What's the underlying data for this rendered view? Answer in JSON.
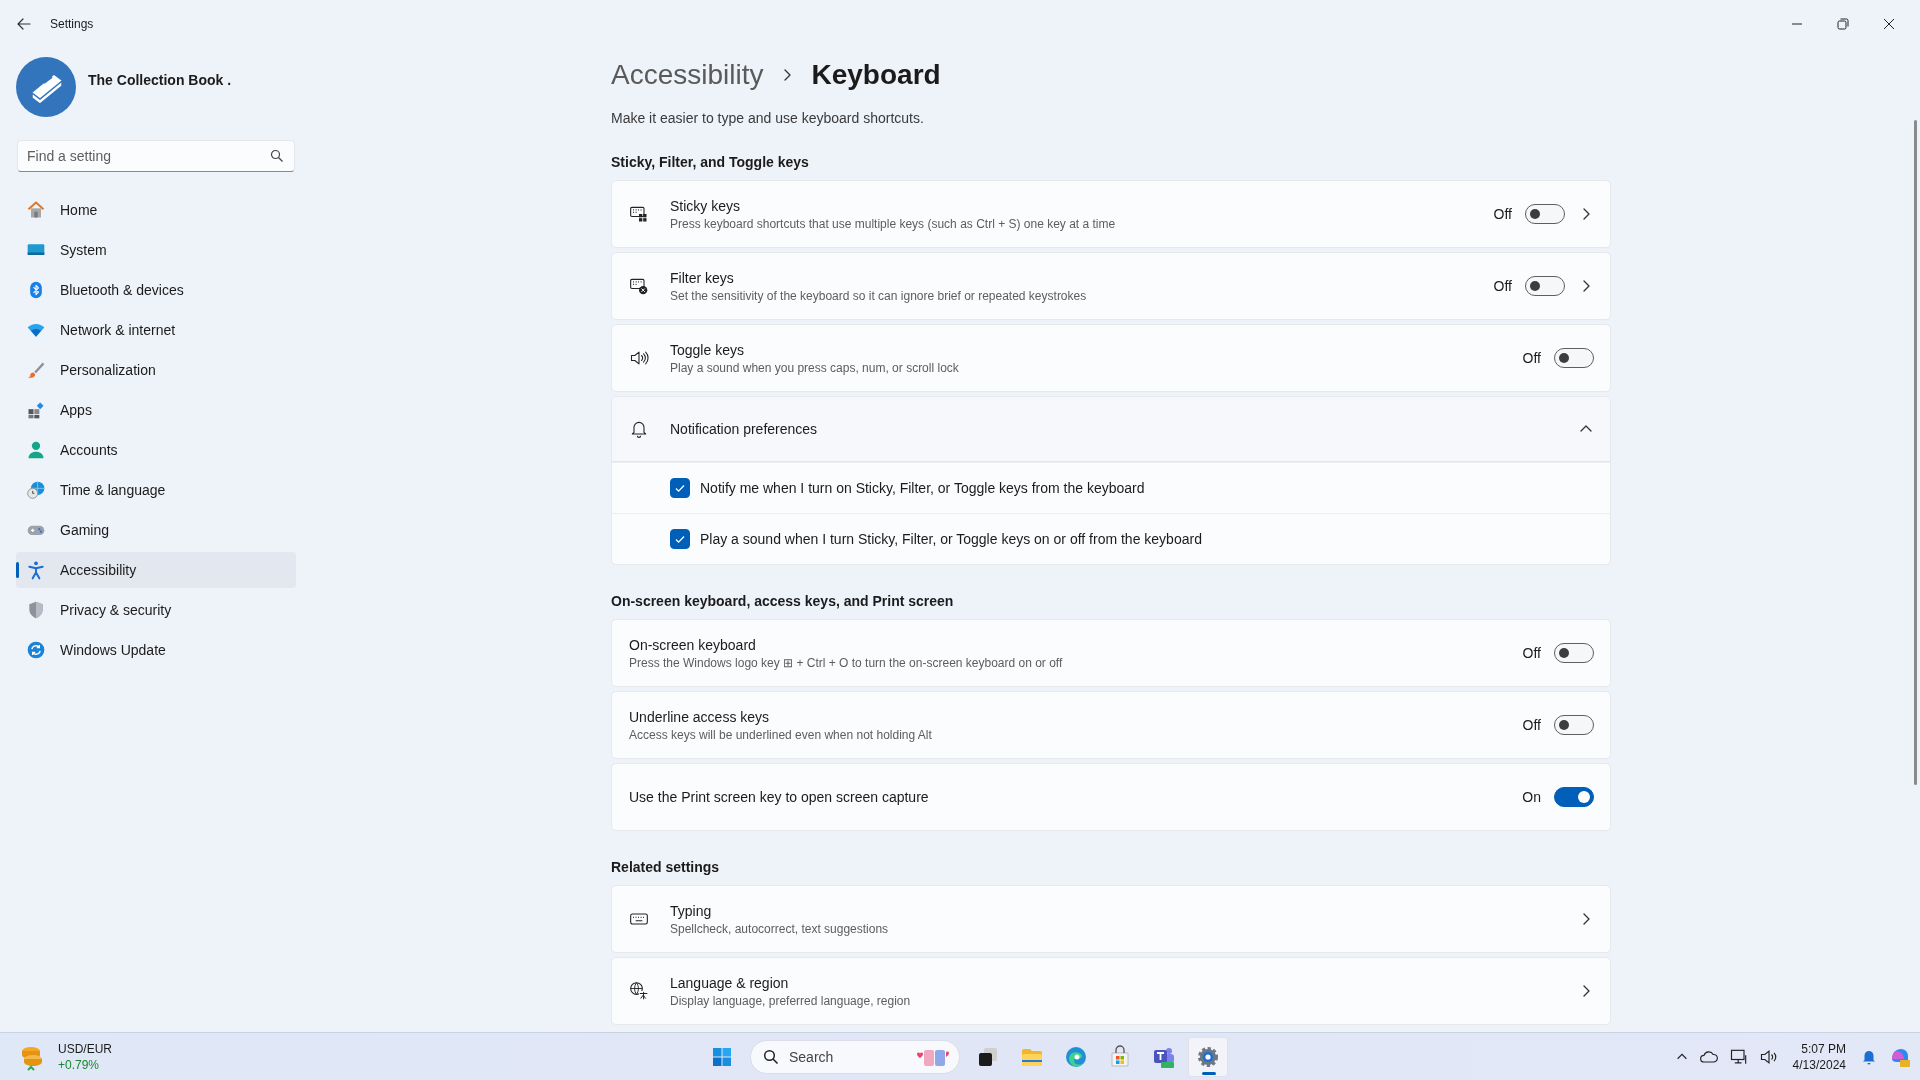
{
  "window": {
    "title": "Settings"
  },
  "profile": {
    "name": "The Collection Book ."
  },
  "search": {
    "placeholder": "Find a setting"
  },
  "nav": {
    "items": [
      {
        "label": "Home",
        "selected": false
      },
      {
        "label": "System",
        "selected": false
      },
      {
        "label": "Bluetooth & devices",
        "selected": false
      },
      {
        "label": "Network & internet",
        "selected": false
      },
      {
        "label": "Personalization",
        "selected": false
      },
      {
        "label": "Apps",
        "selected": false
      },
      {
        "label": "Accounts",
        "selected": false
      },
      {
        "label": "Time & language",
        "selected": false
      },
      {
        "label": "Gaming",
        "selected": false
      },
      {
        "label": "Accessibility",
        "selected": true
      },
      {
        "label": "Privacy & security",
        "selected": false
      },
      {
        "label": "Windows Update",
        "selected": false
      }
    ]
  },
  "breadcrumb": {
    "parent": "Accessibility",
    "current": "Keyboard"
  },
  "description": "Make it easier to type and use keyboard shortcuts.",
  "sections": [
    {
      "heading": "Sticky, Filter, and Toggle keys",
      "cards": [
        {
          "kind": "toggle",
          "title": "Sticky keys",
          "subtitle": "Press keyboard shortcuts that use multiple keys (such as Ctrl + S) one key at a time",
          "state_label": "Off",
          "on": false,
          "chevron": true
        },
        {
          "kind": "toggle",
          "title": "Filter keys",
          "subtitle": "Set the sensitivity of the keyboard so it can ignore brief or repeated keystrokes",
          "state_label": "Off",
          "on": false,
          "chevron": true
        },
        {
          "kind": "toggle",
          "title": "Toggle keys",
          "subtitle": "Play a sound when you press caps, num, or scroll lock",
          "state_label": "Off",
          "on": false,
          "chevron": false
        },
        {
          "kind": "expander",
          "title": "Notification preferences",
          "expanded": true,
          "options": [
            {
              "label": "Notify me when I turn on Sticky, Filter, or Toggle keys from the keyboard",
              "checked": true
            },
            {
              "label": "Play a sound when I turn Sticky, Filter, or Toggle keys on or off from the keyboard",
              "checked": true
            }
          ]
        }
      ]
    },
    {
      "heading": "On-screen keyboard, access keys, and Print screen",
      "cards": [
        {
          "kind": "toggle",
          "title": "On-screen keyboard",
          "subtitle": "Press the Windows logo key ⊞ + Ctrl + O to turn the on-screen keyboard on or off",
          "state_label": "Off",
          "on": false,
          "chevron": false
        },
        {
          "kind": "toggle",
          "title": "Underline access keys",
          "subtitle": "Access keys will be underlined even when not holding Alt",
          "state_label": "Off",
          "on": false,
          "chevron": false
        },
        {
          "kind": "toggle",
          "title": "Use the Print screen key to open screen capture",
          "state_label": "On",
          "on": true,
          "chevron": false
        }
      ]
    },
    {
      "heading": "Related settings",
      "cards": [
        {
          "kind": "link",
          "title": "Typing",
          "subtitle": "Spellcheck, autocorrect, text suggestions"
        },
        {
          "kind": "link",
          "title": "Language & region",
          "subtitle": "Display language, preferred language, region"
        }
      ]
    }
  ],
  "taskbar": {
    "widget": {
      "title": "USD/EUR",
      "change": "+0.79%"
    },
    "search": {
      "placeholder": "Search"
    },
    "apps": [
      {
        "selected": false
      },
      {
        "selected": false
      },
      {
        "selected": false
      },
      {
        "selected": false
      },
      {
        "selected": false
      },
      {
        "selected": false
      },
      {
        "selected": true
      }
    ],
    "clock": {
      "time": "5:07 PM",
      "date": "4/13/2024"
    }
  }
}
